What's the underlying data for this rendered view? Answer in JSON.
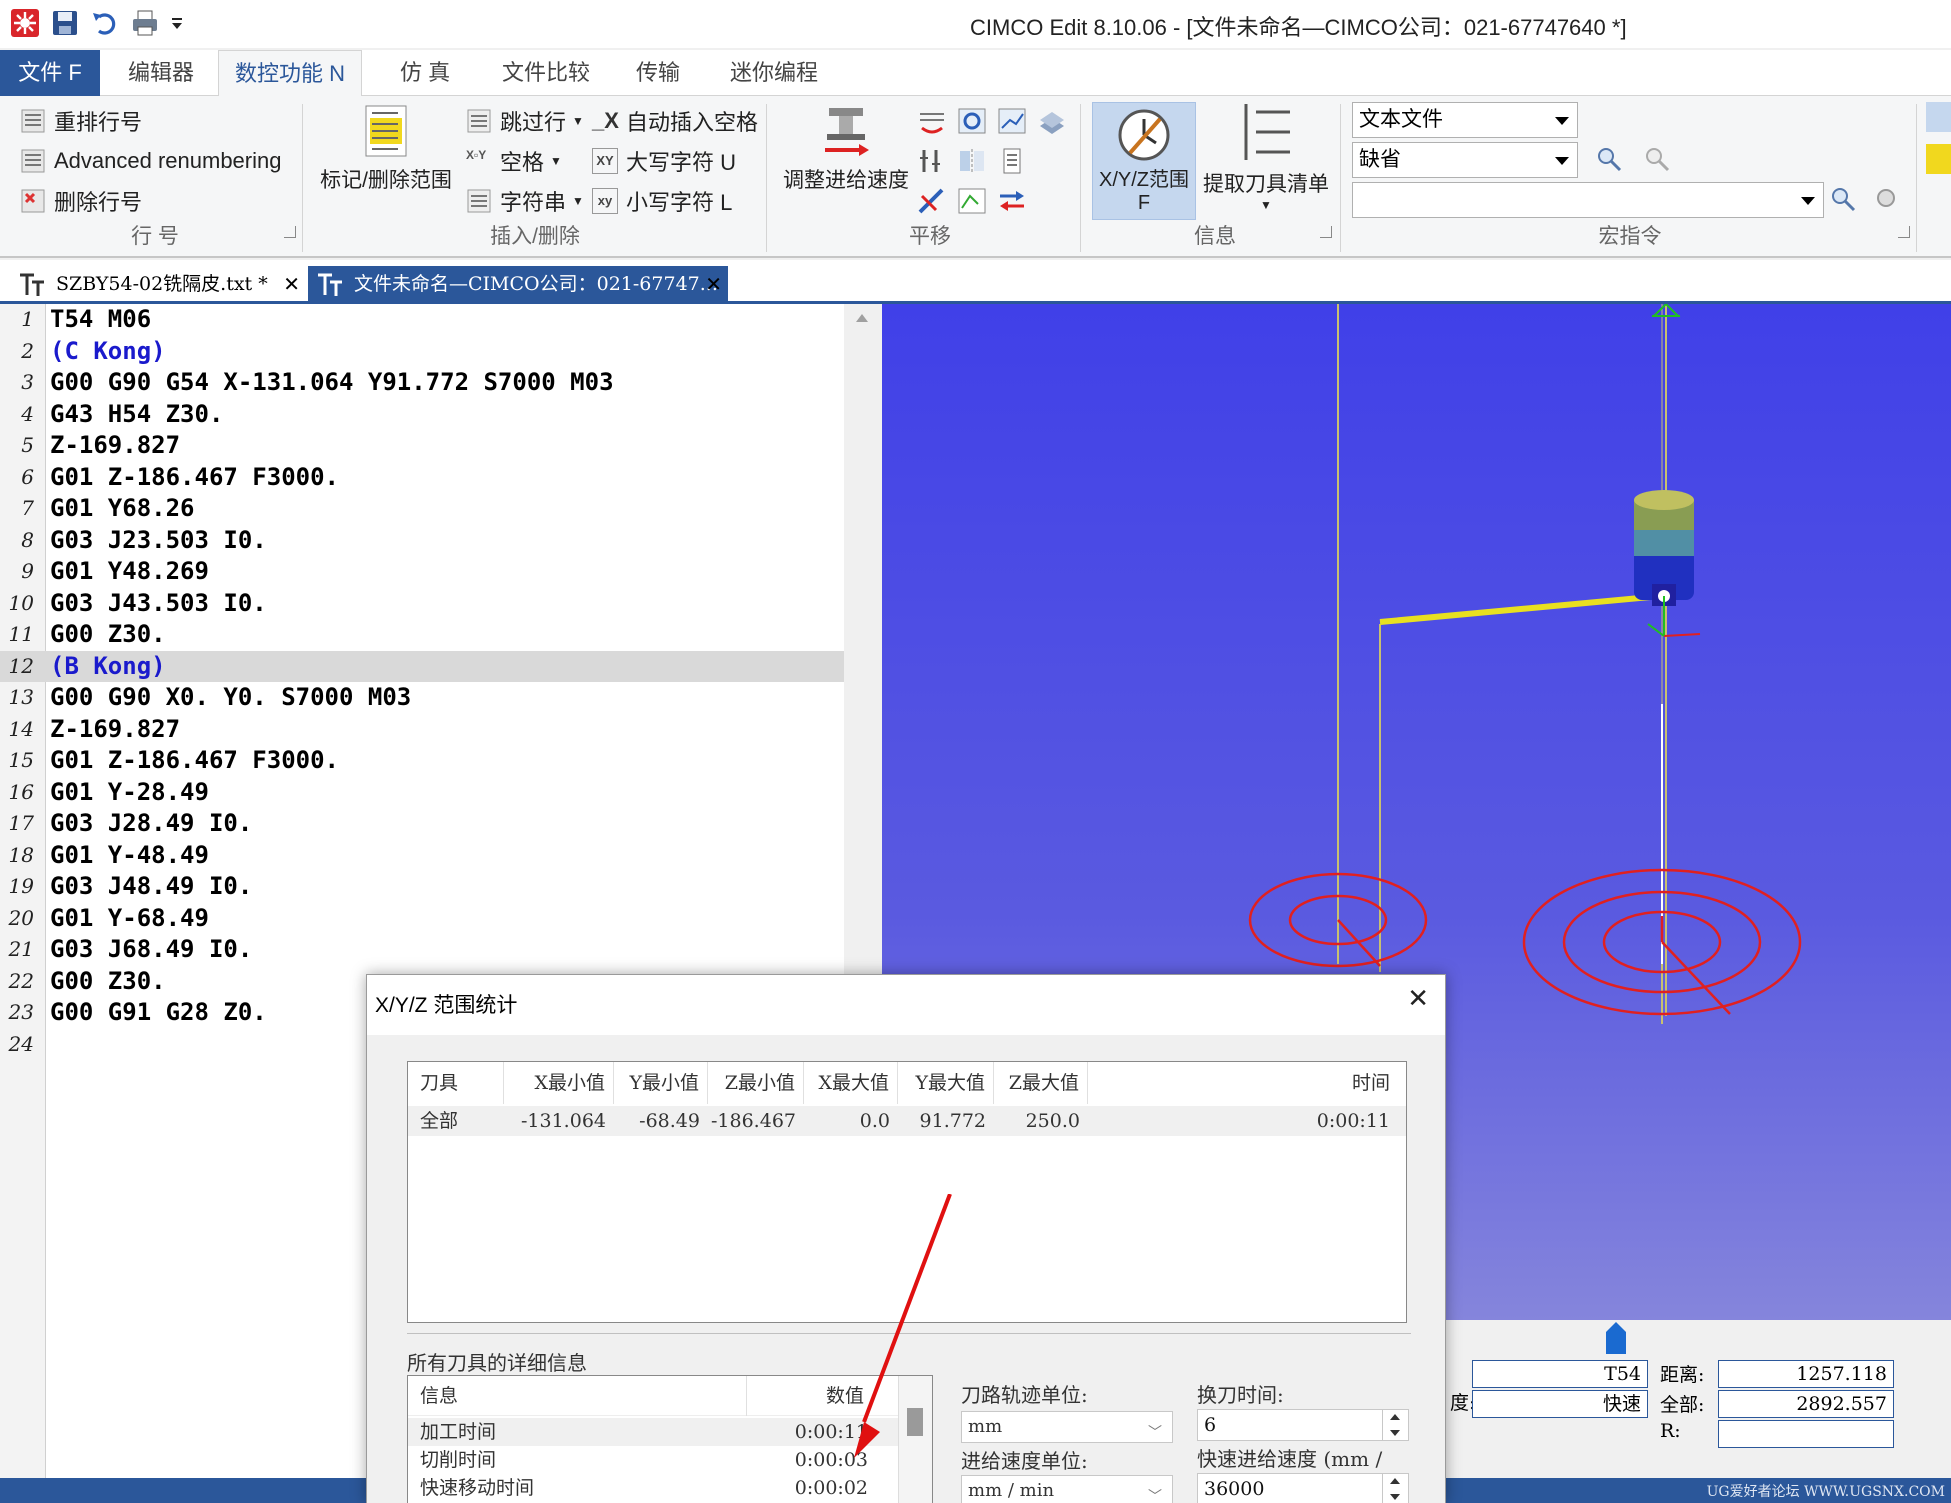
{
  "window": {
    "title": "CIMCO Edit 8.10.06 - [文件未命名—CIMCO公司：021-67747640 *]"
  },
  "quick_access": [
    "app-logo-icon",
    "save-icon",
    "undo-icon",
    "print-icon",
    "customize-icon"
  ],
  "ribbon_tabs": [
    "文件 F",
    "编辑器",
    "数控功能 N",
    "仿 真",
    "文件比较",
    "传输",
    "迷你编程"
  ],
  "ribbon": {
    "line_number_group": {
      "label": "行 号",
      "items": [
        "重排行号",
        "Advanced renumbering",
        "删除行号"
      ]
    },
    "insert_delete_group": {
      "label": "插入/删除",
      "big_button": "标记/删除范围",
      "items": [
        "跳过行",
        "空格",
        "字符串",
        "自动插入空格",
        "大写字符 U",
        "小写字符 L"
      ]
    },
    "translate_group": {
      "label": "平移",
      "big_button": "调整进给速度"
    },
    "info_group": {
      "label": "信息",
      "xyz_button_line1": "X/Y/Z范围",
      "xyz_button_line2": "F",
      "tool_list_button": "提取刀具清单"
    },
    "macro_group": {
      "label": "宏指令",
      "combo1": "文本文件",
      "combo2": "缺省",
      "combo3": ""
    }
  },
  "doc_tabs": [
    {
      "label": "SZBY54-02铣隔皮.txt *",
      "active": false
    },
    {
      "label": "文件未命名—CIMCO公司：021-67747...",
      "active": true
    }
  ],
  "code_lines": [
    {
      "n": "1",
      "text": "T54 M06",
      "comment": false
    },
    {
      "n": "2",
      "text": "(C Kong)",
      "comment": true
    },
    {
      "n": "3",
      "text": "G00 G90 G54 X-131.064 Y91.772 S7000 M03",
      "comment": false
    },
    {
      "n": "4",
      "text": "G43 H54 Z30.",
      "comment": false
    },
    {
      "n": "5",
      "text": "Z-169.827",
      "comment": false
    },
    {
      "n": "6",
      "text": "G01 Z-186.467 F3000.",
      "comment": false
    },
    {
      "n": "7",
      "text": "G01 Y68.26",
      "comment": false
    },
    {
      "n": "8",
      "text": "G03 J23.503 I0.",
      "comment": false
    },
    {
      "n": "9",
      "text": "G01 Y48.269",
      "comment": false
    },
    {
      "n": "10",
      "text": "G03 J43.503 I0.",
      "comment": false
    },
    {
      "n": "11",
      "text": "G00 Z30.",
      "comment": false
    },
    {
      "n": "12",
      "text": "(B Kong)",
      "comment": true
    },
    {
      "n": "13",
      "text": "G00 G90 X0. Y0. S7000 M03",
      "comment": false
    },
    {
      "n": "14",
      "text": "Z-169.827",
      "comment": false
    },
    {
      "n": "15",
      "text": "G01 Z-186.467 F3000.",
      "comment": false
    },
    {
      "n": "16",
      "text": "G01 Y-28.49",
      "comment": false
    },
    {
      "n": "17",
      "text": "G03 J28.49 I0.",
      "comment": false
    },
    {
      "n": "18",
      "text": "G01 Y-48.49",
      "comment": false
    },
    {
      "n": "19",
      "text": "G03 J48.49 I0.",
      "comment": false
    },
    {
      "n": "20",
      "text": "G01 Y-68.49",
      "comment": false
    },
    {
      "n": "21",
      "text": "G03 J68.49 I0.",
      "comment": false
    },
    {
      "n": "22",
      "text": "G00 Z30.",
      "comment": false
    },
    {
      "n": "23",
      "text": "G00 G91 G28 Z0.",
      "comment": false
    },
    {
      "n": "24",
      "text": "",
      "comment": false
    }
  ],
  "highlighted_line": "12",
  "sim_panel": {
    "tool_value": "T54",
    "mode_value": "快速",
    "distance_label": "距离:",
    "distance_value": "1257.118",
    "total_label": "全部:",
    "total_value": "2892.557",
    "r_label": "R:",
    "r_value": "",
    "partial_label": "度:"
  },
  "watermark": "UG爱好者论坛 WWW.UGSNX.COM",
  "dialog": {
    "title": "X/Y/Z 范围统计",
    "range_table": {
      "headers": [
        "刀具",
        "X最小值",
        "Y最小值",
        "Z最小值",
        "X最大值",
        "Y最大值",
        "Z最大值",
        "时间"
      ],
      "rows": [
        [
          "全部",
          "-131.064",
          "-68.49",
          "-186.467",
          "0.0",
          "91.772",
          "250.0",
          "0:00:11"
        ]
      ]
    },
    "details_label": "所有刀具的详细信息",
    "details_table": {
      "headers": [
        "信息",
        "数值"
      ],
      "rows": [
        [
          "加工时间",
          "0:00:11"
        ],
        [
          "切削时间",
          "0:00:03"
        ],
        [
          "快速移动时间",
          "0:00:02"
        ]
      ]
    },
    "toolpath_unit_label": "刀路轨迹单位:",
    "toolpath_unit_value": "mm",
    "feed_unit_label": "进给速度单位:",
    "feed_unit_value": "mm / min",
    "tool_change_label": "换刀时间:",
    "tool_change_value": "6",
    "rapid_feed_label": "快速进给速度 (mm /",
    "rapid_feed_value": "36000"
  },
  "colors": {
    "accent": "#2b579a",
    "viewport_bg": "#4a4ae6",
    "toolpath_red": "#e02020",
    "toolpath_yellow": "#e8e020",
    "comment_blue": "#1a1acc",
    "annotation_arrow": "#e01010"
  }
}
